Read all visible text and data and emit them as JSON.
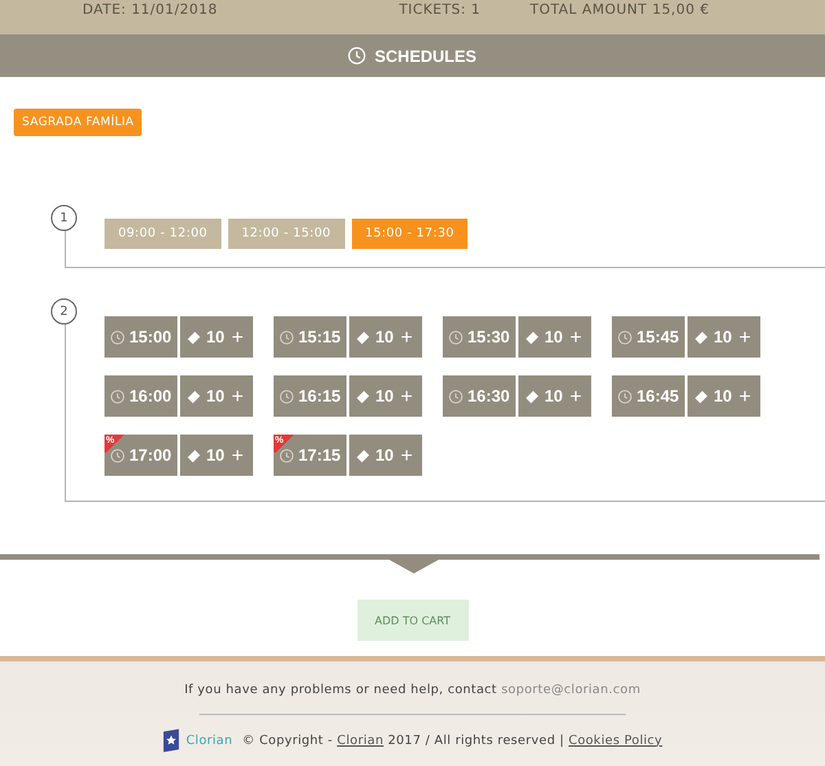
{
  "summary": {
    "date": "DATE: 11/01/2018",
    "tickets": "TICKETS: 1",
    "total": "TOTAL AMOUNT  15,00 €"
  },
  "schedules_header": {
    "title": "SCHEDULES"
  },
  "venue_tag": "SAGRADA FAMÍLIA",
  "steps": [
    {
      "number": "1"
    },
    {
      "number": "2"
    }
  ],
  "ranges": [
    {
      "label": "09:00 - 12:00",
      "selected": false
    },
    {
      "label": "12:00 - 15:00",
      "selected": false
    },
    {
      "label": "15:00 - 17:30",
      "selected": true
    }
  ],
  "slots": [
    {
      "time": "15:00",
      "tickets": "10",
      "plus": "+"
    },
    {
      "time": "15:15",
      "tickets": "10",
      "plus": "+"
    },
    {
      "time": "15:30",
      "tickets": "10",
      "plus": "+"
    },
    {
      "time": "15:45",
      "tickets": "10",
      "plus": "+"
    },
    {
      "time": "16:00",
      "tickets": "10",
      "plus": "+"
    },
    {
      "time": "16:15",
      "tickets": "10",
      "plus": "+"
    },
    {
      "time": "16:30",
      "tickets": "10",
      "plus": "+"
    },
    {
      "time": "16:45",
      "tickets": "10",
      "plus": "+"
    },
    {
      "time": "17:00",
      "tickets": "10",
      "plus": "+",
      "badge": "%"
    },
    {
      "time": "17:15",
      "tickets": "10",
      "plus": "+",
      "badge": "%"
    }
  ],
  "add_to_cart": {
    "label": "ADD TO CART",
    "disabled": true
  },
  "footer": {
    "help": "If you have any problems or need help, contact ",
    "email": "soporte@clorian.com",
    "logo": "Clorian",
    "copyright": "© Copyright - ",
    "company": "Clorian",
    "rights": " 2017 / All rights reserved | ",
    "cookies": "Cookies Policy"
  }
}
